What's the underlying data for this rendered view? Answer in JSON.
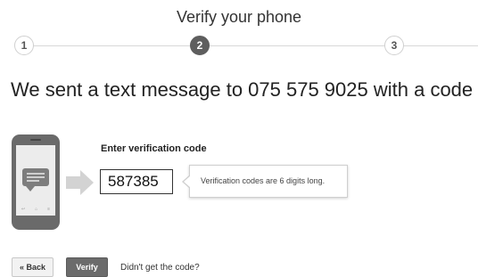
{
  "header": {
    "title": "Verify your phone",
    "steps": [
      {
        "label": "1",
        "state": "inactive"
      },
      {
        "label": "2",
        "state": "active"
      },
      {
        "label": "3",
        "state": "inactive"
      }
    ]
  },
  "main": {
    "headline": "We sent a text message to 075 575 9025 with a code",
    "code_label": "Enter verification code",
    "code_value": "587385",
    "tooltip": "Verification codes are 6 digits long."
  },
  "footer": {
    "back_label": "« Back",
    "verify_label": "Verify",
    "resend_link": "Didn't get the code?"
  },
  "colors": {
    "active_step": "#5e5e5e",
    "verify_button": "#6b6b6b",
    "phone_body": "#6a6a6a"
  },
  "icons": {
    "phone": "smartphone-icon",
    "message": "message-bubble-icon",
    "arrow": "arrow-right-icon"
  }
}
